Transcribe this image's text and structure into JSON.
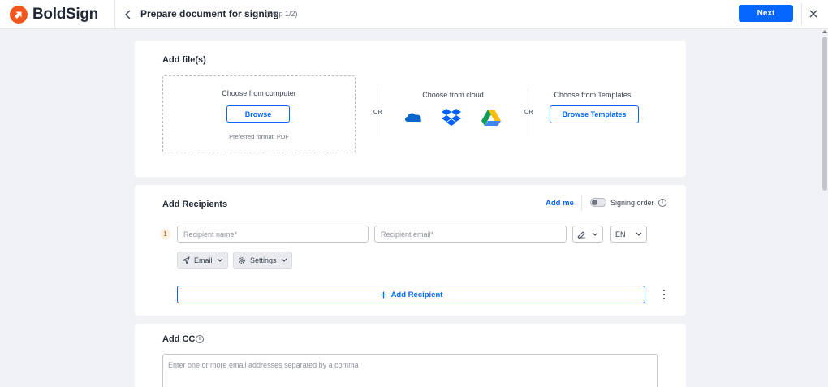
{
  "header": {
    "brand_name": "BoldSign",
    "page_title": "Prepare document for signing",
    "step_label": "(Step 1/2)",
    "next_label": "Next"
  },
  "files": {
    "title": "Add file(s)",
    "computer_heading": "Choose from computer",
    "browse_label": "Browse",
    "preferred_format": "Preferred format: PDF",
    "or_1": "OR",
    "cloud_heading": "Choose from cloud",
    "cloud_icons": [
      "onedrive-icon",
      "dropbox-icon",
      "google-drive-icon"
    ],
    "or_2": "OR",
    "templates_heading": "Choose from Templates",
    "browse_templates_label": "Browse Templates"
  },
  "recipients": {
    "title": "Add Recipients",
    "add_me_label": "Add me",
    "signing_order_label": "Signing order",
    "signing_order_enabled": false,
    "row": {
      "number": "1",
      "name_placeholder": "Recipient name*",
      "email_placeholder": "Recipient email*",
      "language_value": "EN",
      "delivery_label": "Email",
      "settings_label": "Settings"
    },
    "add_recipient_label": "Add Recipient"
  },
  "cc": {
    "title": "Add CC",
    "placeholder": "Enter one or more email addresses separated by a comma"
  },
  "colors": {
    "accent": "#0565ff",
    "brand": "#f0561d"
  }
}
